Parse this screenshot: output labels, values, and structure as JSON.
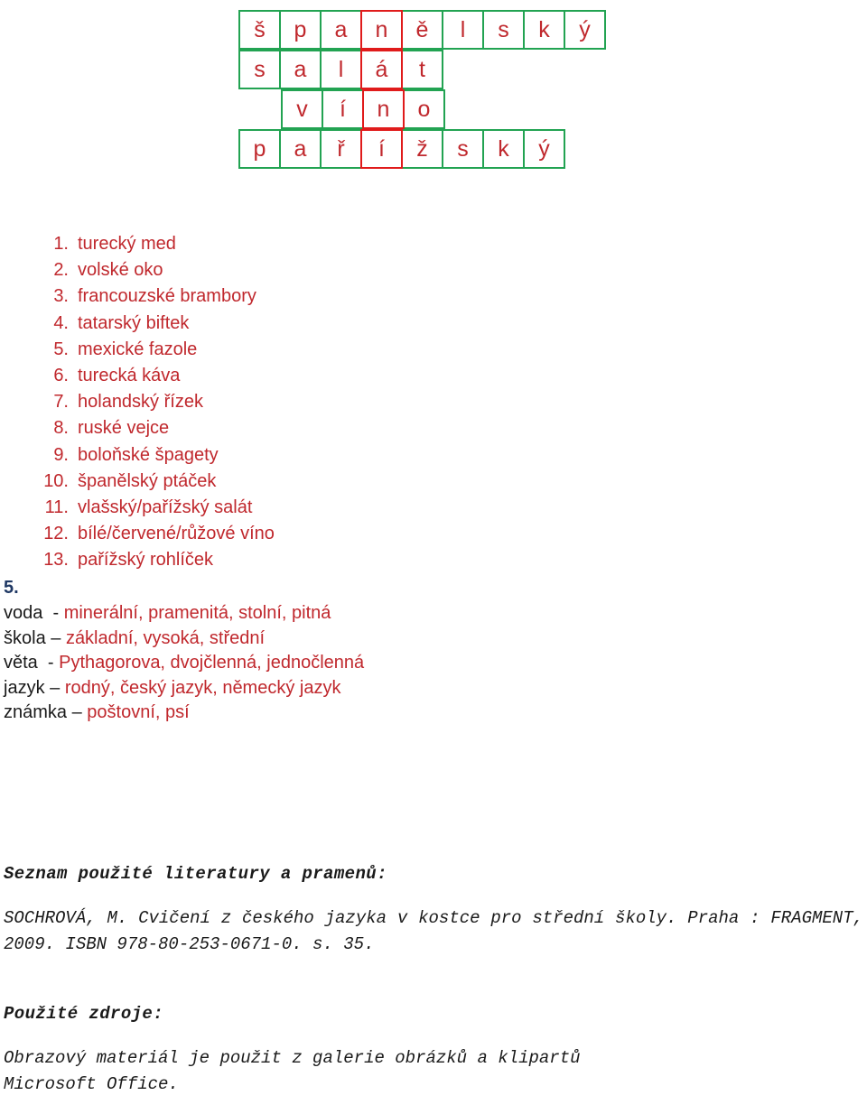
{
  "crossword": {
    "rows": [
      [
        {
          "letter": "š",
          "style": "green"
        },
        {
          "letter": "p",
          "style": "green"
        },
        {
          "letter": "a",
          "style": "green"
        },
        {
          "letter": "n",
          "style": "red"
        },
        {
          "letter": "ě",
          "style": "green"
        },
        {
          "letter": "l",
          "style": "green"
        },
        {
          "letter": "s",
          "style": "green"
        },
        {
          "letter": "k",
          "style": "green"
        },
        {
          "letter": "ý",
          "style": "green"
        }
      ],
      [
        {
          "letter": "s",
          "style": "green"
        },
        {
          "letter": "a",
          "style": "green"
        },
        {
          "letter": "l",
          "style": "green"
        },
        {
          "letter": "á",
          "style": "red"
        },
        {
          "letter": "t",
          "style": "green"
        },
        {
          "letter": "",
          "style": "blank"
        },
        {
          "letter": "",
          "style": "blank"
        },
        {
          "letter": "",
          "style": "blank"
        },
        {
          "letter": "",
          "style": "blank"
        }
      ],
      [
        {
          "letter": "",
          "style": "blank"
        },
        {
          "letter": "v",
          "style": "green"
        },
        {
          "letter": "í",
          "style": "green"
        },
        {
          "letter": "n",
          "style": "red"
        },
        {
          "letter": "o",
          "style": "green"
        },
        {
          "letter": "",
          "style": "blank"
        },
        {
          "letter": "",
          "style": "blank"
        },
        {
          "letter": "",
          "style": "blank"
        },
        {
          "letter": "",
          "style": "blank"
        }
      ],
      [
        {
          "letter": "p",
          "style": "green"
        },
        {
          "letter": "a",
          "style": "green"
        },
        {
          "letter": "ř",
          "style": "green"
        },
        {
          "letter": "í",
          "style": "red"
        },
        {
          "letter": "ž",
          "style": "green"
        },
        {
          "letter": "s",
          "style": "green"
        },
        {
          "letter": "k",
          "style": "green"
        },
        {
          "letter": "ý",
          "style": "green"
        },
        {
          "letter": "",
          "style": "blank"
        }
      ]
    ],
    "colors": {
      "letter": "#C0282D",
      "green_border": "#22A352",
      "red_border": "#E01B1B"
    }
  },
  "clue_list": [
    {
      "num": "1.",
      "text": "turecký med"
    },
    {
      "num": "2.",
      "text": "volské oko"
    },
    {
      "num": "3.",
      "text": "francouzské brambory"
    },
    {
      "num": "4.",
      "text": "tatarský biftek"
    },
    {
      "num": "5.",
      "text": "mexické fazole"
    },
    {
      "num": "6.",
      "text": "turecká káva"
    },
    {
      "num": "7.",
      "text": "holandský řízek"
    },
    {
      "num": "8.",
      "text": "ruské vejce"
    },
    {
      "num": "9.",
      "text": "boloňské špagety"
    },
    {
      "num": "10.",
      "text": "španělský ptáček"
    },
    {
      "num": "11.",
      "text": "vlašský/pařížský salát"
    },
    {
      "num": "12.",
      "text": "bílé/červené/růžové víno"
    },
    {
      "num": "13.",
      "text": "pařížský rohlíček"
    }
  ],
  "section5": {
    "heading": "5.",
    "heading_color": "#1F3864",
    "lines": [
      {
        "key": "voda  - ",
        "value": "minerální, pramenitá, stolní, pitná"
      },
      {
        "key": "škola – ",
        "value": "základní, vysoká, střední"
      },
      {
        "key": "věta  - ",
        "value": "Pythagorova, dvojčlenná, jednočlenná"
      },
      {
        "key": "jazyk – ",
        "value": "rodný, český jazyk, německý jazyk"
      },
      {
        "key": "známka – ",
        "value": "poštovní, psí"
      }
    ]
  },
  "bibliography": {
    "heading": "Seznam použité literatury a pramenů:",
    "body": "SOCHROVÁ, M. Cvičení z českého jazyka v kostce pro střední školy. Praha : FRAGMENT, 2009. ISBN 978-80-253-0671-0. s. 35."
  },
  "sources": {
    "heading": "Použité zdroje:",
    "body_line1": "Obrazový materiál je použit z galerie obrázků a klipartů",
    "body_line2": "Microsoft Office."
  }
}
